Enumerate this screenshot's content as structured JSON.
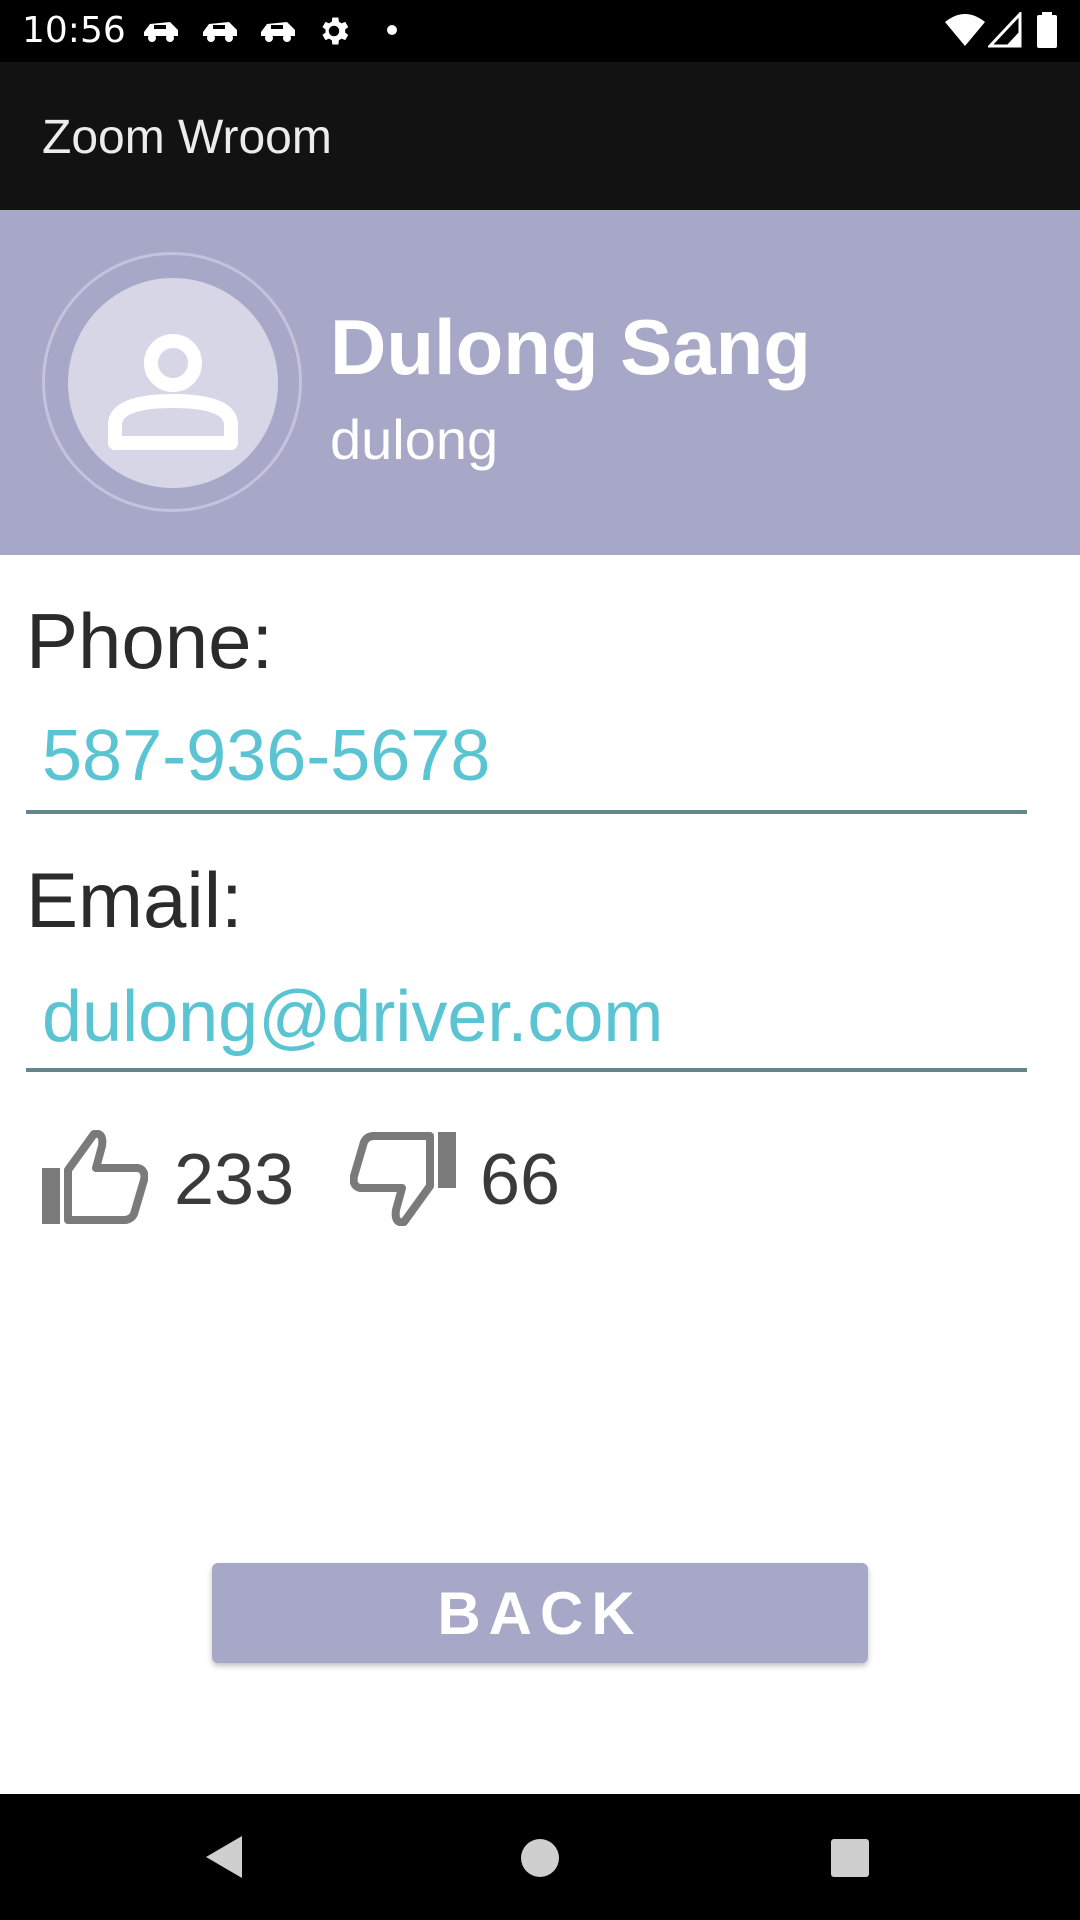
{
  "status_bar": {
    "time": "10:56",
    "notification_icons": [
      "car-notification-icon",
      "car-notification-icon",
      "car-notification-icon",
      "settings-gear-icon",
      "dot-icon"
    ],
    "right_icons": [
      "wifi-icon",
      "cellular-signal-icon",
      "battery-icon"
    ]
  },
  "app_bar": {
    "title": "Zoom Wroom"
  },
  "profile": {
    "name": "Dulong Sang",
    "username": "dulong",
    "avatar_icon": "person-icon"
  },
  "phone": {
    "label": "Phone:",
    "value": "587-936-5678"
  },
  "email": {
    "label": "Email:",
    "value": "dulong@driver.com"
  },
  "votes": {
    "thumbs_up_icon": "thumbs-up-icon",
    "thumbs_up_count": "233",
    "thumbs_down_icon": "thumbs-down-icon",
    "thumbs_down_count": "66"
  },
  "back_button": {
    "label": "BACK"
  },
  "nav_bar": {
    "buttons": [
      "back-triangle-icon",
      "home-circle-icon",
      "recents-square-icon"
    ]
  },
  "colors": {
    "header_bg": "#a7a7c8",
    "app_bar_bg": "#121212",
    "link_text": "#5bc4d3",
    "underline": "#62868c"
  }
}
